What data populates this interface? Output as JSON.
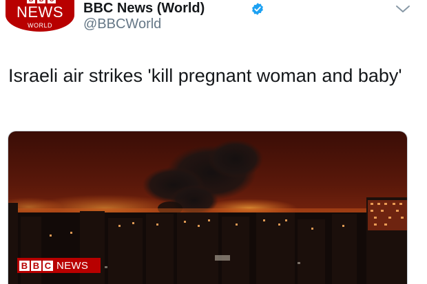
{
  "account": {
    "avatar_top": [
      "B",
      "B",
      "C"
    ],
    "avatar_main": "NEWS",
    "avatar_sub": "WORLD",
    "display_name": "BBC News (World)",
    "handle": "@BBCWorld",
    "verified": true
  },
  "tweet": {
    "text": "Israeli air strikes 'kill pregnant woman and baby'"
  },
  "media": {
    "badge_letters": [
      "B",
      "B",
      "C"
    ],
    "badge_word": "NEWS"
  },
  "colors": {
    "bbc_red": "#b80000",
    "verified_blue": "#1da1f2",
    "text_primary": "#14171a",
    "text_secondary": "#657786"
  },
  "icons": {
    "verified": "verified-badge-icon",
    "caret": "chevron-down-icon"
  }
}
